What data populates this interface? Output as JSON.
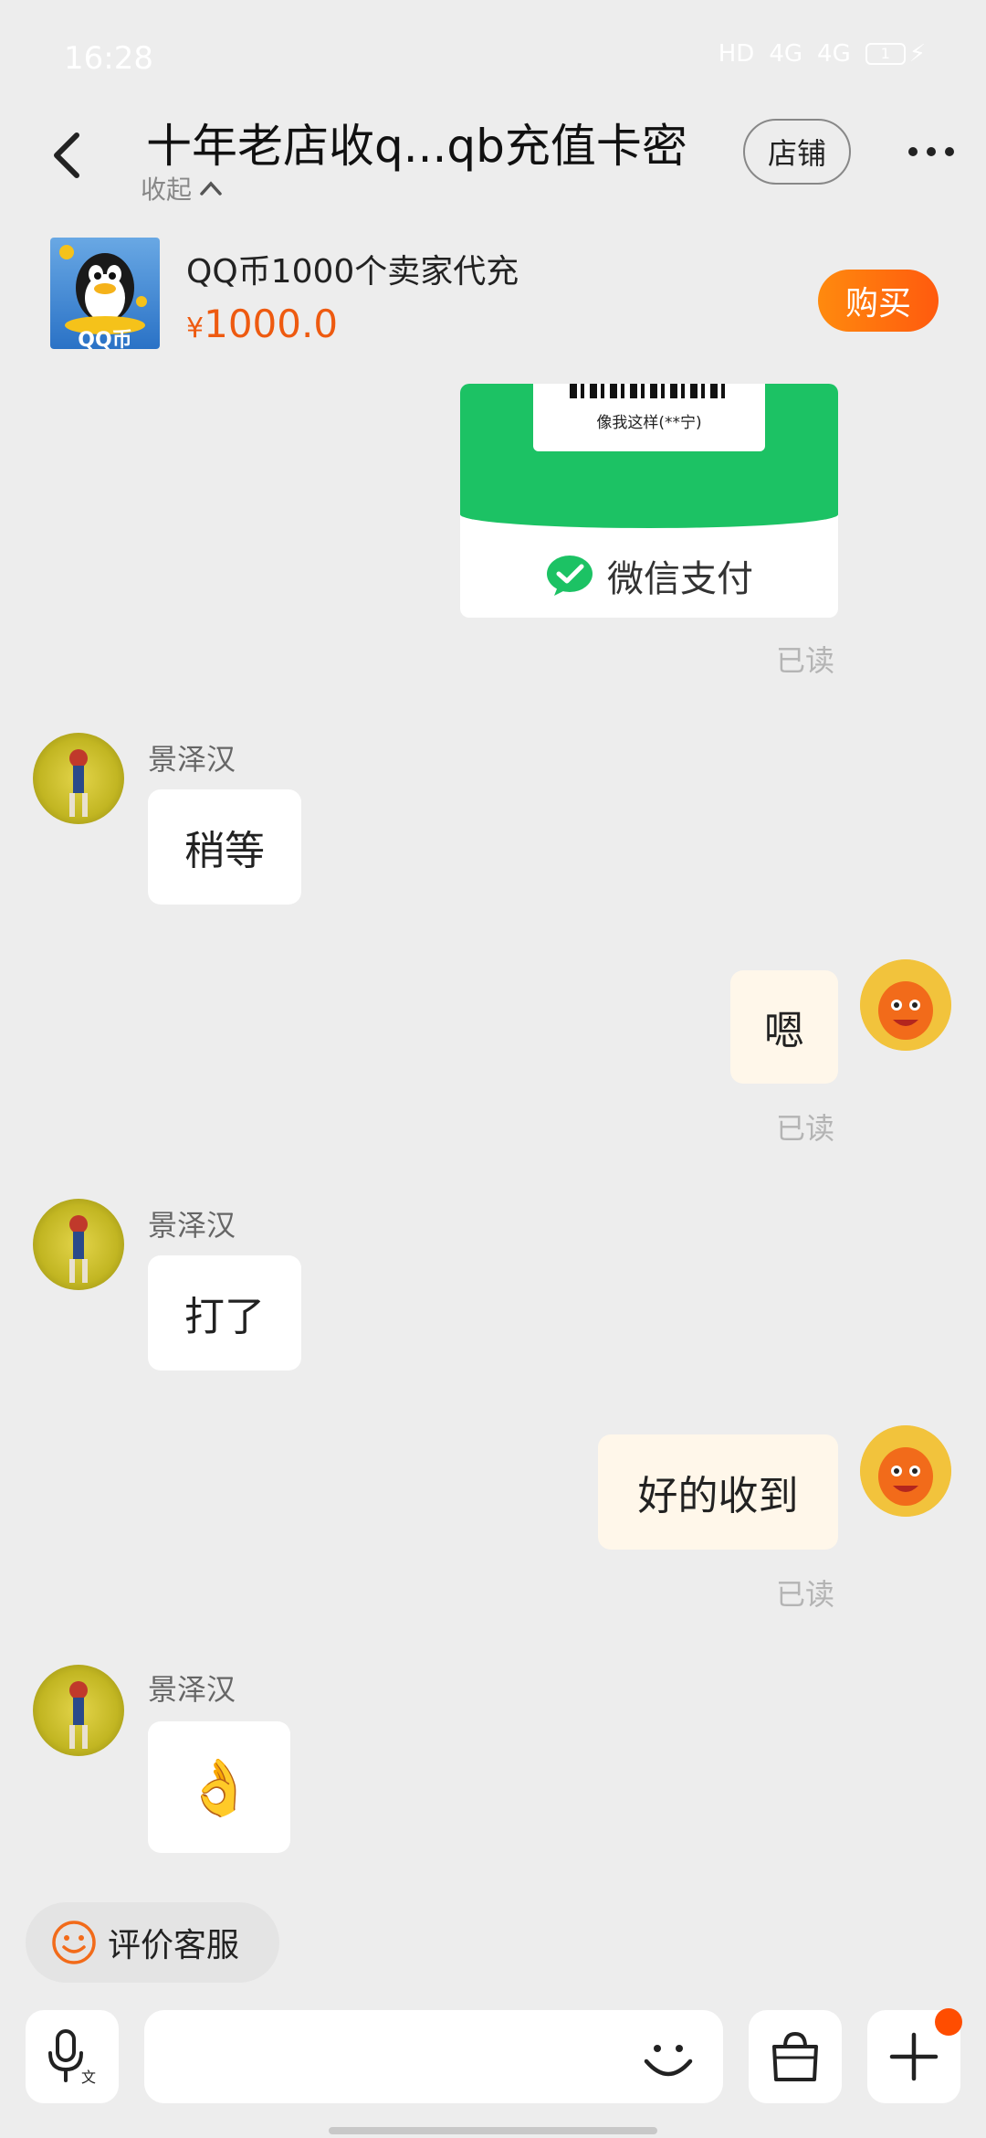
{
  "status_bar": {
    "time": "16:28",
    "network_1": "HD",
    "network_2": "4G",
    "network_3": "4G",
    "battery": "1"
  },
  "header": {
    "title": "十年老店收q...qb充值卡密",
    "collapse_label": "收起",
    "store_label": "店铺"
  },
  "product": {
    "name": "QQ币1000个卖家代充",
    "currency": "¥",
    "price": "1000.0",
    "thumb_label": "QQ币",
    "buy_label": "购买"
  },
  "payment_card": {
    "caption": "像我这样(**宁)",
    "label": "微信支付",
    "brand_color": "#1cc264"
  },
  "messages": [
    {
      "direction": "out",
      "type": "payment_card",
      "status": "已读"
    },
    {
      "direction": "in",
      "sender": "景泽汉",
      "text": "稍等"
    },
    {
      "direction": "out",
      "text": "嗯",
      "status": "已读"
    },
    {
      "direction": "in",
      "sender": "景泽汉",
      "text": "打了"
    },
    {
      "direction": "out",
      "text": "好的收到",
      "status": "已读"
    },
    {
      "direction": "in",
      "sender": "景泽汉",
      "text": "👌"
    }
  ],
  "quick_actions": {
    "rate_service": "评价客服"
  },
  "input_bar": {
    "placeholder": "",
    "mic_icon": "voice-to-text-icon",
    "emoji_icon": "smile-icon",
    "bag_icon": "shopping-bag-icon",
    "plus_icon": "plus-icon"
  },
  "colors": {
    "accent": "#ff6a0e",
    "price": "#ee5a10",
    "background": "#ededed"
  }
}
